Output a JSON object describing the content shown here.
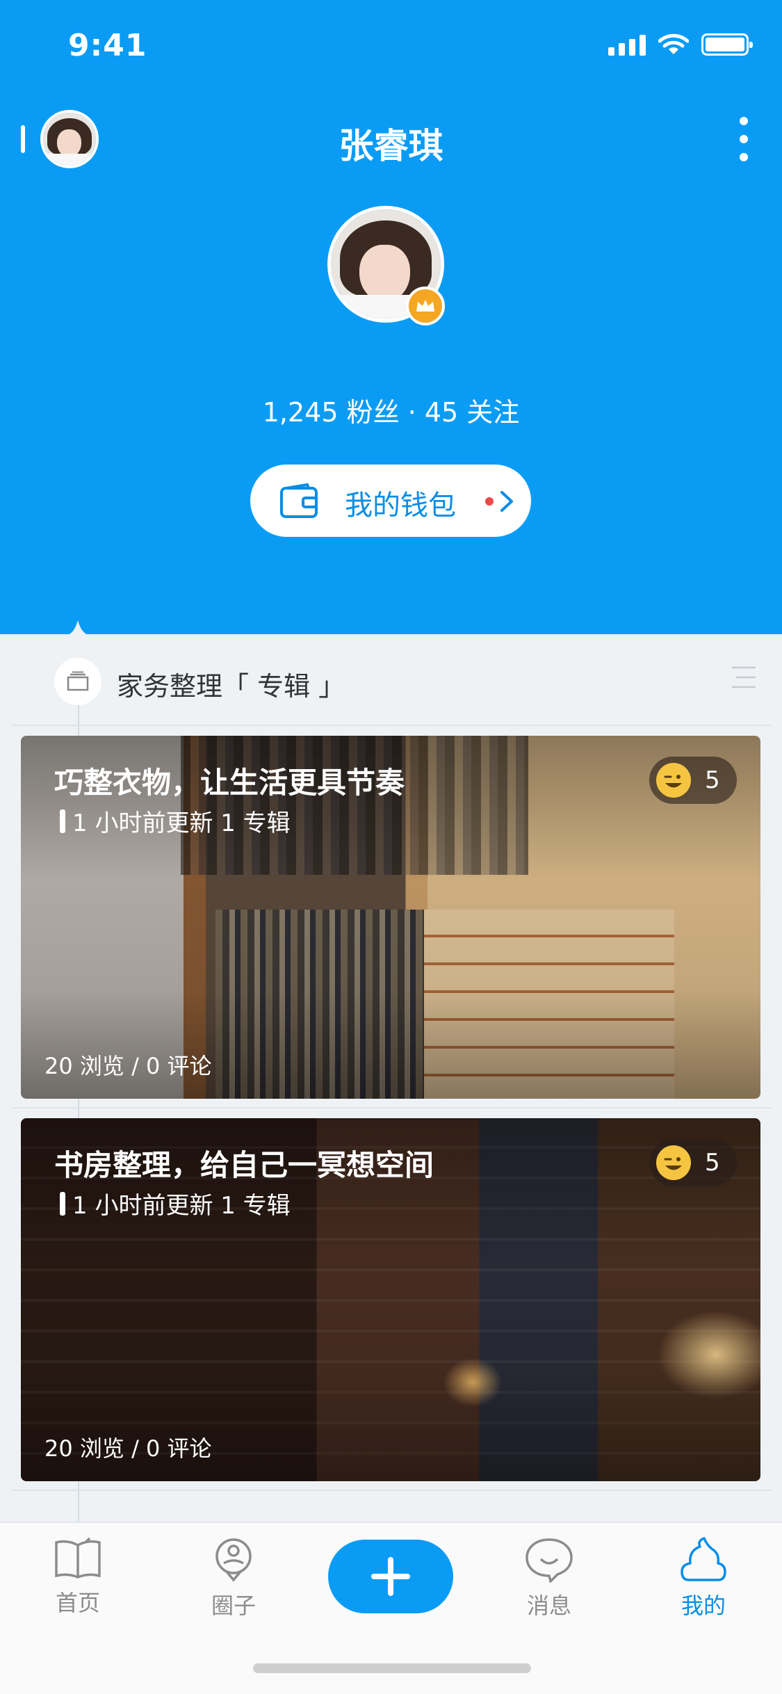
{
  "status": {
    "time": "9:41"
  },
  "nav": {
    "title": "张睿琪"
  },
  "profile": {
    "stats": "1,245 粉丝 · 45 关注",
    "wallet_label": "我的钱包"
  },
  "album": {
    "title": "家务整理「 专辑 」"
  },
  "cards": [
    {
      "title": "巧整衣物，让生活更具节奏",
      "meta": "1 小时前更新  1 专辑",
      "emoji_count": "5",
      "footer": "20 浏览  /  0 评论"
    },
    {
      "title": "书房整理，给自己一冥想空间",
      "meta": "1 小时前更新  1 专辑",
      "emoji_count": "5",
      "footer": "20 浏览  /  0 评论"
    }
  ],
  "tabs": [
    {
      "label": "首页",
      "icon": "book-icon"
    },
    {
      "label": "圈子",
      "icon": "circle-person-icon"
    },
    {
      "label": "",
      "icon": "plus-icon"
    },
    {
      "label": "消息",
      "icon": "chat-bubble-icon"
    },
    {
      "label": "我的",
      "icon": "me-icon"
    }
  ],
  "colors": {
    "brand_blue": "#0a9cf5",
    "link_blue": "#0a8de6",
    "badge_orange": "#f5a623",
    "notify_red": "#f04848"
  }
}
